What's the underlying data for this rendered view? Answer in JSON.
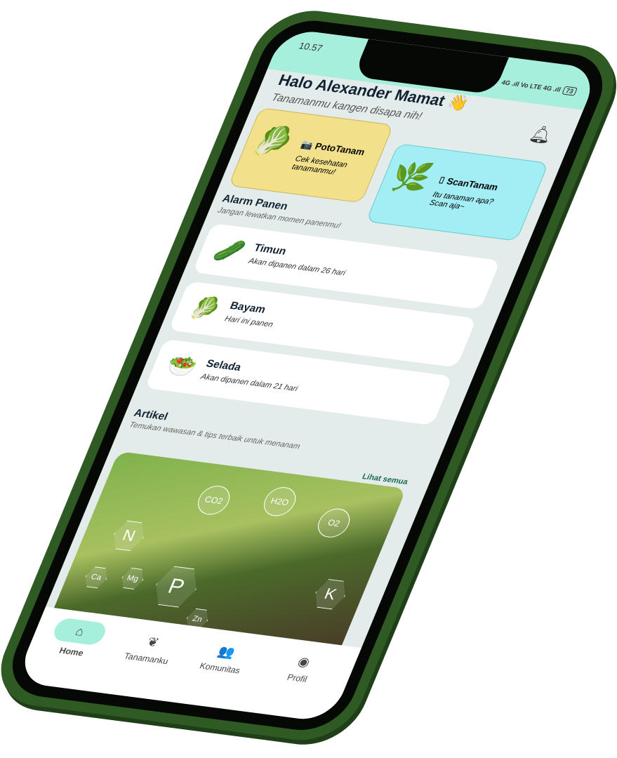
{
  "status": {
    "time": "10.57",
    "signal": "4G .ıll  Vo LTE  4G .ıll",
    "battery": "73"
  },
  "header": {
    "greeting": "Halo Alexander Mamat",
    "wave": "👋",
    "subtitle": "Tanamanmu kangen disapa nih!"
  },
  "cards": [
    {
      "title": "PotoTanam",
      "desc": "Cek kesehatan tanamanmu!",
      "icon": "📷",
      "image": "🥬"
    },
    {
      "title": "ScanTanam",
      "desc": "Itu tanaman apa? Scan aja~",
      "icon": "⌷",
      "image": "🌿"
    }
  ],
  "alarm": {
    "title": "Alarm Panen",
    "subtitle": "Jangan lewatkan momen panenmu!",
    "items": [
      {
        "name": "Timun",
        "desc": "Akan dipanen dalam 26 hari",
        "icon": "🥒"
      },
      {
        "name": "Bayam",
        "desc": "Hari ini panen",
        "icon": "🥬"
      },
      {
        "name": "Selada",
        "desc": "Akan dipanen dalam 21 hari",
        "icon": "🥗"
      }
    ]
  },
  "artikel": {
    "title": "Artikel",
    "subtitle": "Temukan wawasan & tips terbaik untuk menanam",
    "see_all": "Lihat semua",
    "image_labels": [
      "N",
      "P",
      "K",
      "Ca",
      "Mg",
      "Zn",
      "CO2",
      "H2O",
      "O2"
    ]
  },
  "nav": [
    {
      "label": "Home",
      "icon": "⌂"
    },
    {
      "label": "Tanamanku",
      "icon": "❦"
    },
    {
      "label": "Komunitas",
      "icon": "👥"
    },
    {
      "label": "Profil",
      "icon": "◉"
    }
  ]
}
